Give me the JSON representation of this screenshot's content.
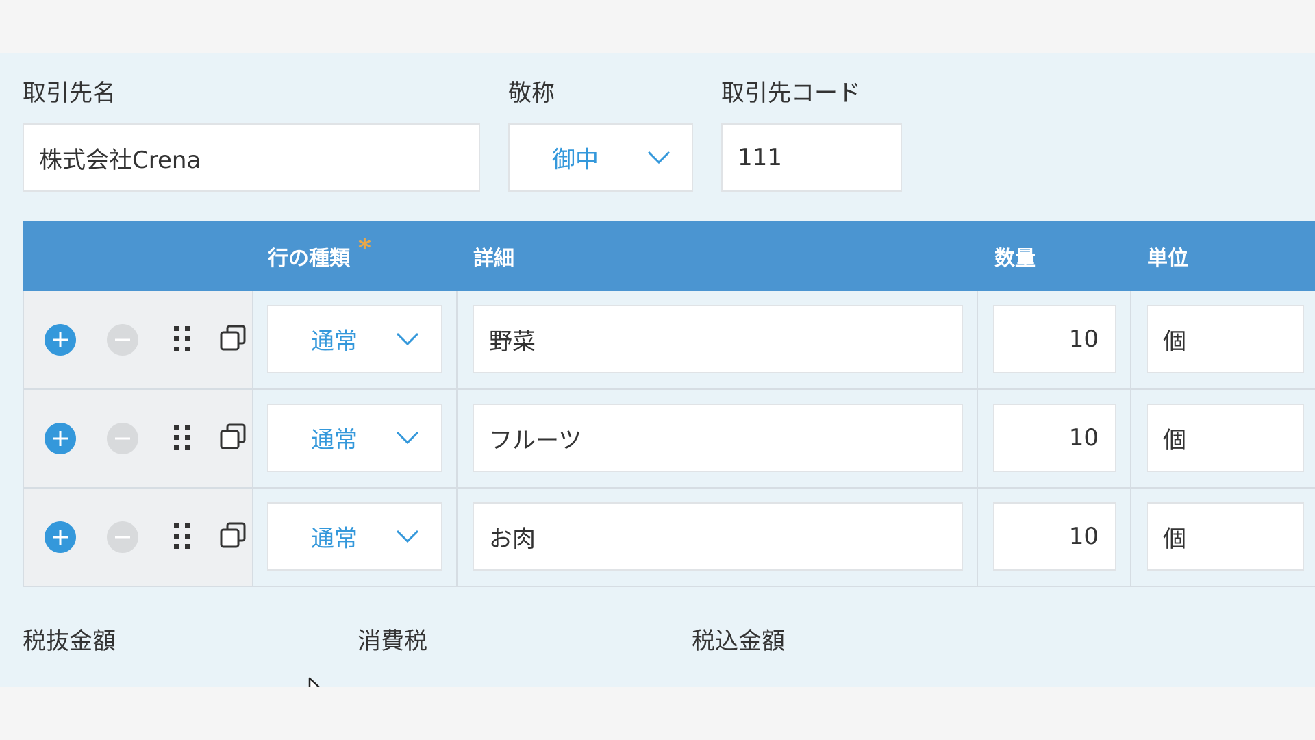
{
  "header": {
    "client_name_label": "取引先名",
    "client_name_value": "株式会社Crena",
    "honorific_label": "敬称",
    "honorific_value": "御中",
    "client_code_label": "取引先コード",
    "client_code_value": "111"
  },
  "table": {
    "columns": {
      "row_type": "行の種類",
      "required_mark": "*",
      "detail": "詳細",
      "quantity": "数量",
      "unit": "単位"
    },
    "rows": [
      {
        "row_type": "通常",
        "detail": "野菜",
        "quantity": "10",
        "unit": "個"
      },
      {
        "row_type": "通常",
        "detail": "フルーツ",
        "quantity": "10",
        "unit": "個"
      },
      {
        "row_type": "通常",
        "detail": "お肉",
        "quantity": "10",
        "unit": "個"
      }
    ]
  },
  "summary": {
    "subtotal_label": "税抜金額",
    "tax_label": "消費税",
    "total_label": "税込金額"
  },
  "colors": {
    "accent": "#3498db",
    "header_bg": "#4b95d1",
    "panel_bg": "#e9f3f8",
    "required": "#e8a84a"
  },
  "icons": [
    "add-row-icon",
    "remove-row-icon",
    "drag-handle-icon",
    "copy-row-icon",
    "chevron-down-icon",
    "mouse-cursor-icon"
  ]
}
